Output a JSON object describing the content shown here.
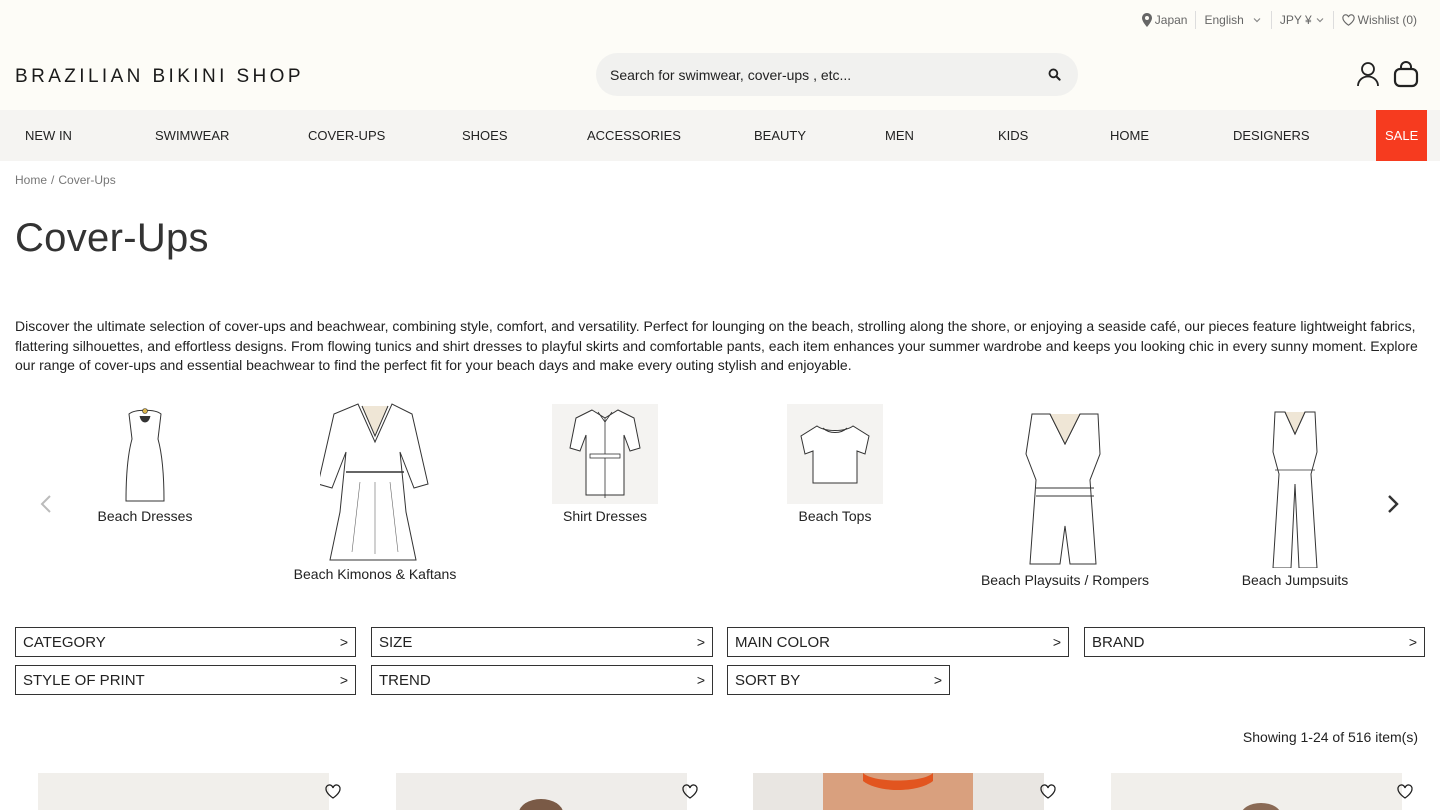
{
  "utility": {
    "country": "Japan",
    "language": "English",
    "currency": "JPY ¥",
    "wishlist": "Wishlist (0)"
  },
  "brand": {
    "logo": "BRAZILIAN BIKINI SHOP"
  },
  "search": {
    "placeholder": "Search for swimwear, cover-ups , etc..."
  },
  "nav": {
    "items": [
      "NEW IN",
      "SWIMWEAR",
      "COVER-UPS",
      "SHOES",
      "ACCESSORIES",
      "BEAUTY",
      "MEN",
      "KIDS",
      "HOME",
      "DESIGNERS"
    ],
    "sale": "SALE",
    "sale_color": "#f63b1f"
  },
  "breadcrumb": {
    "home": "Home",
    "current": "Cover-Ups",
    "separator": "/"
  },
  "page": {
    "title": "Cover-Ups",
    "description": "Discover the ultimate selection of cover-ups and beachwear, combining style, comfort, and versatility. Perfect for lounging on the beach, strolling along the shore, or enjoying a seaside café, our pieces feature lightweight fabrics, flattering silhouettes, and effortless designs. From flowing tunics and shirt dresses to playful skirts and comfortable pants, each item enhances your summer wardrobe and keeps you looking chic in every sunny moment. Explore our range of cover-ups and essential beachwear to find the perfect fit for your beach days and make every outing stylish and enjoyable."
  },
  "categories": [
    {
      "label": "Beach Dresses",
      "icon": "strapless-dress-icon"
    },
    {
      "label": "Beach Kimonos & Kaftans",
      "icon": "kaftan-icon"
    },
    {
      "label": "Shirt Dresses",
      "icon": "shirt-dress-icon"
    },
    {
      "label": "Beach Tops",
      "icon": "crop-top-icon"
    },
    {
      "label": "Beach Playsuits / Rompers",
      "icon": "romper-icon"
    },
    {
      "label": "Beach Jumpsuits",
      "icon": "jumpsuit-icon"
    }
  ],
  "filters": {
    "category": "CATEGORY",
    "size": "SIZE",
    "main_color": "MAIN COLOR",
    "brand": "BRAND",
    "style_of_print": "STYLE OF PRINT",
    "trend": "TREND",
    "sort_by": "SORT BY",
    "chevron": ">"
  },
  "results": {
    "count": "Showing 1-24 of 516 item(s)"
  }
}
